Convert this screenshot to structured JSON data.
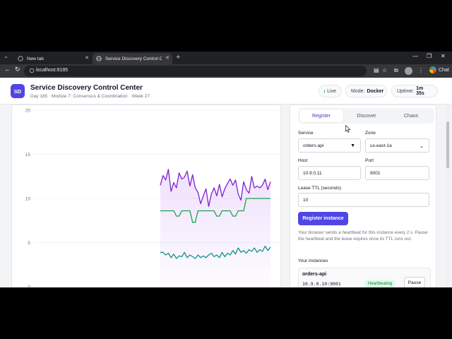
{
  "browser": {
    "tabs": [
      {
        "label": "New tab"
      },
      {
        "label": "Service Discovery Control Center"
      }
    ],
    "url": "localhost:8185",
    "chat_label": "Chat"
  },
  "header": {
    "logo": "SD",
    "title": "Service Discovery Control Center",
    "subtitle": "Day 185 · Module 7: Consensus & Coordination · Week 27",
    "live": "Live",
    "mode_label": "Mode:",
    "mode_value": "Docker",
    "uptime_label": "Uptime:",
    "uptime_value": "1m 35s"
  },
  "chart_data": {
    "type": "line",
    "y_ticks": [
      0,
      5,
      10,
      15,
      20
    ],
    "ylim": [
      0,
      20
    ],
    "grid": true,
    "series": [
      {
        "color": "#7e22ce",
        "fill": true,
        "values": [
          11.5,
          12.6,
          12.1,
          13.3,
          10.8,
          11.8,
          11.2,
          12.9,
          12.2,
          12.4,
          13.1,
          11.4,
          12.7,
          11.2,
          10.7,
          9.4,
          10.3,
          11.1,
          9.1,
          10.5,
          11.2,
          10.3,
          11.6,
          10.2,
          11.1,
          11.7,
          12.2,
          11.5,
          12.1,
          10.5,
          9.8,
          11.9,
          11.0,
          10.6,
          12.5,
          11.2,
          11.4,
          11.2,
          11.5,
          12.2,
          11.0,
          11.9
        ]
      },
      {
        "color": "#16a34a",
        "fill": false,
        "values": [
          8.6,
          8.6,
          8.6,
          8.6,
          8.6,
          8.6,
          8.0,
          8.0,
          8.6,
          8.6,
          8.6,
          8.6,
          7.3,
          7.3,
          8.6,
          8.6,
          8.6,
          8.6,
          8.6,
          8.6,
          8.6,
          8.0,
          8.0,
          8.6,
          8.6,
          8.6,
          8.6,
          8.0,
          8.0,
          8.6,
          8.6,
          8.6,
          10.0,
          10.0,
          10.0,
          10.0,
          10.0,
          10.0,
          10.0,
          10.0,
          10.0,
          10.0
        ]
      },
      {
        "color": "#0d9488",
        "fill": false,
        "values": [
          3.9,
          3.9,
          3.6,
          3.8,
          3.3,
          3.7,
          3.2,
          3.5,
          3.4,
          3.9,
          3.3,
          3.6,
          3.4,
          3.2,
          3.6,
          3.3,
          3.5,
          3.3,
          3.6,
          3.8,
          3.4,
          3.6,
          3.3,
          3.9,
          3.4,
          3.8,
          3.6,
          4.1,
          3.7,
          4.4,
          3.9,
          4.1,
          3.8,
          4.2,
          4.0,
          4.4,
          3.9,
          4.2,
          4.0,
          4.6,
          4.1,
          4.5
        ]
      }
    ]
  },
  "panel": {
    "tabs": [
      {
        "label": "Register",
        "active": true
      },
      {
        "label": "Discover",
        "active": false
      },
      {
        "label": "Chaos",
        "active": false
      }
    ],
    "service_label": "Service",
    "service_value": "orders-api",
    "zone_label": "Zone",
    "zone_value": "us-east-1a",
    "host_label": "Host",
    "host_value": "10.9.0.11",
    "port_label": "Port",
    "port_value": "9001",
    "ttl_label": "Lease TTL (seconds)",
    "ttl_value": "10",
    "register_button": "Register instance",
    "help_text": "Your browser sends a heartbeat for this instance every 2 s. Pause the heartbeat and the lease expires once its TTL runs out.",
    "instances_label": "Your instances",
    "instances": [
      {
        "name": "orders-api",
        "address": "10.9.0.10:9001",
        "status": "Heartbeating",
        "action": "Pause"
      }
    ]
  }
}
